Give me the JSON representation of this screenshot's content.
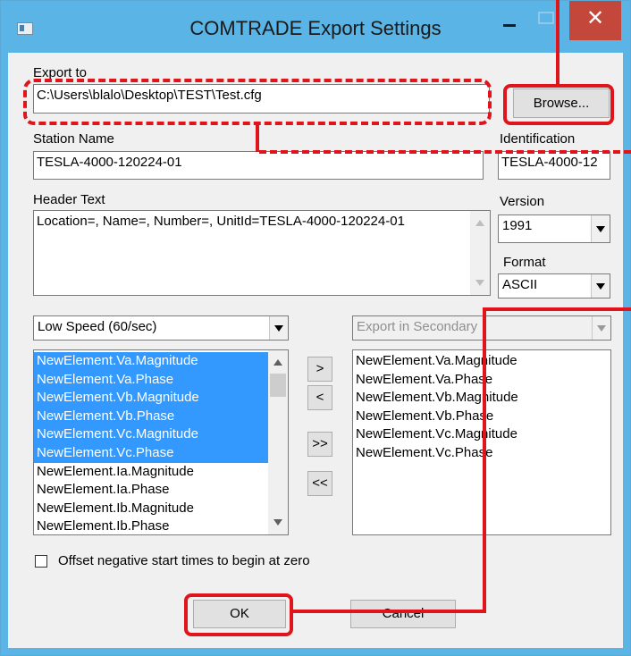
{
  "window": {
    "title": "COMTRADE Export Settings",
    "close_glyph": "✕"
  },
  "export": {
    "label": "Export to",
    "path": "C:\\Users\\blalo\\Desktop\\TEST\\Test.cfg",
    "browse_label": "Browse..."
  },
  "station": {
    "label": "Station Name",
    "value": "TESLA-4000-120224-01"
  },
  "identification": {
    "label": "Identification",
    "value": "TESLA-4000-12"
  },
  "header_text": {
    "label": "Header Text",
    "value": "Location=, Name=, Number=, UnitId=TESLA-4000-120224-01"
  },
  "version": {
    "label": "Version",
    "selected": "1991"
  },
  "format": {
    "label": "Format",
    "selected": "ASCII"
  },
  "speed": {
    "selected": "Low Speed (60/sec)"
  },
  "secondary": {
    "selected": "Export in Secondary"
  },
  "available_list": [
    {
      "label": "NewElement.Va.Magnitude",
      "selected": true
    },
    {
      "label": "NewElement.Va.Phase",
      "selected": true
    },
    {
      "label": "NewElement.Vb.Magnitude",
      "selected": true
    },
    {
      "label": "NewElement.Vb.Phase",
      "selected": true
    },
    {
      "label": "NewElement.Vc.Magnitude",
      "selected": true
    },
    {
      "label": "NewElement.Vc.Phase",
      "selected": true
    },
    {
      "label": "NewElement.Ia.Magnitude",
      "selected": false
    },
    {
      "label": "NewElement.Ia.Phase",
      "selected": false
    },
    {
      "label": "NewElement.Ib.Magnitude",
      "selected": false
    },
    {
      "label": "NewElement.Ib.Phase",
      "selected": false
    }
  ],
  "export_list": [
    "NewElement.Va.Magnitude",
    "NewElement.Va.Phase",
    "NewElement.Vb.Magnitude",
    "NewElement.Vb.Phase",
    "NewElement.Vc.Magnitude",
    "NewElement.Vc.Phase"
  ],
  "move_buttons": {
    "add": ">",
    "remove": "<",
    "add_all": ">>",
    "remove_all": "<<"
  },
  "offset": {
    "label": "Offset negative start times to begin at zero",
    "checked": false
  },
  "buttons": {
    "ok": "OK",
    "cancel": "Cancel"
  },
  "colors": {
    "title_bar": "#5ab4e6",
    "close_button": "#c4473c",
    "selection": "#3399ff",
    "annotation": "#e0141b"
  }
}
